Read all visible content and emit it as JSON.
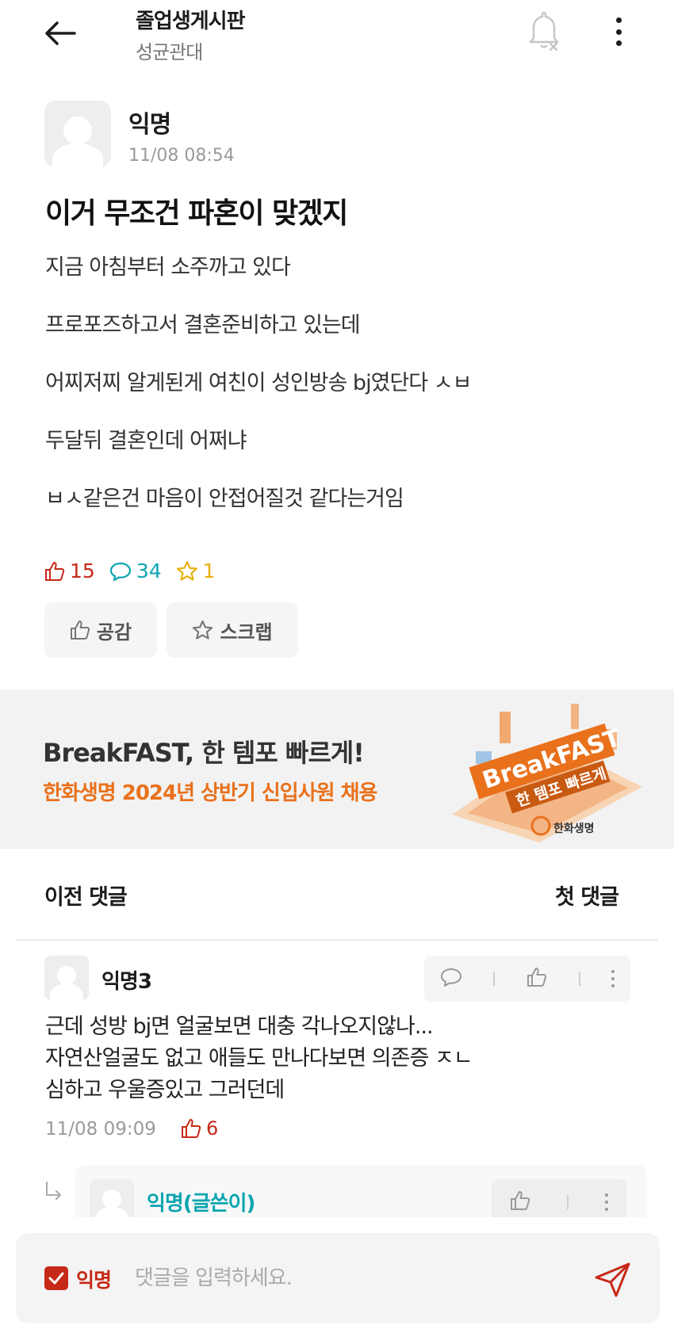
{
  "header": {
    "board_title": "졸업생게시판",
    "board_subtitle": "성균관대",
    "icons": [
      "back-arrow-icon",
      "notification-off-icon",
      "more-vertical-icon"
    ]
  },
  "post": {
    "author": "익명",
    "time": "11/08 08:54",
    "title": "이거 무조건 파혼이 맞겠지",
    "body": [
      "지금 아침부터 소주까고 있다",
      "프로포즈하고서 결혼준비하고 있는데",
      "어찌저찌 알게된게 여친이 성인방송 bj였단다 ㅅㅂ",
      "두달뒤 결혼인데 어쩌냐",
      "ㅂㅅ같은건 마음이 안접어질것 같다는거임"
    ],
    "stats": {
      "likes": "15",
      "comments": "34",
      "scraps": "1"
    },
    "like_button": "공감",
    "scrap_button": "스크랩"
  },
  "ad": {
    "line1": "BreakFAST, 한 템포 빠르게!",
    "line2": "한화생명 2024년 상반기 신입사원 채용",
    "graphic_text": "BreakFAST",
    "graphic_sub": "한 템포 빠르게",
    "brand": "한화생명"
  },
  "comments_nav": {
    "prev": "이전 댓글",
    "first": "첫 댓글"
  },
  "comment": {
    "author": "익명3",
    "lines": [
      "근데 성방 bj면 얼굴보면 대충 각나오지않나...",
      "자연산얼굴도 없고 애들도 만나다보면 의존증 ㅈㄴ",
      "심하고 우울증있고 그러던데"
    ],
    "time": "11/08 09:09",
    "likes": "6"
  },
  "reply": {
    "author": "익명(글쓴이)"
  },
  "input_bar": {
    "anonymous_label": "익명",
    "anonymous_checked": true,
    "placeholder": "댓글을 입력하세요."
  },
  "colors": {
    "accent_red": "#c62917",
    "comment_teal": "#0ca5b0",
    "scrap_yellow": "#e8b20d",
    "ad_orange": "#e9711c"
  }
}
